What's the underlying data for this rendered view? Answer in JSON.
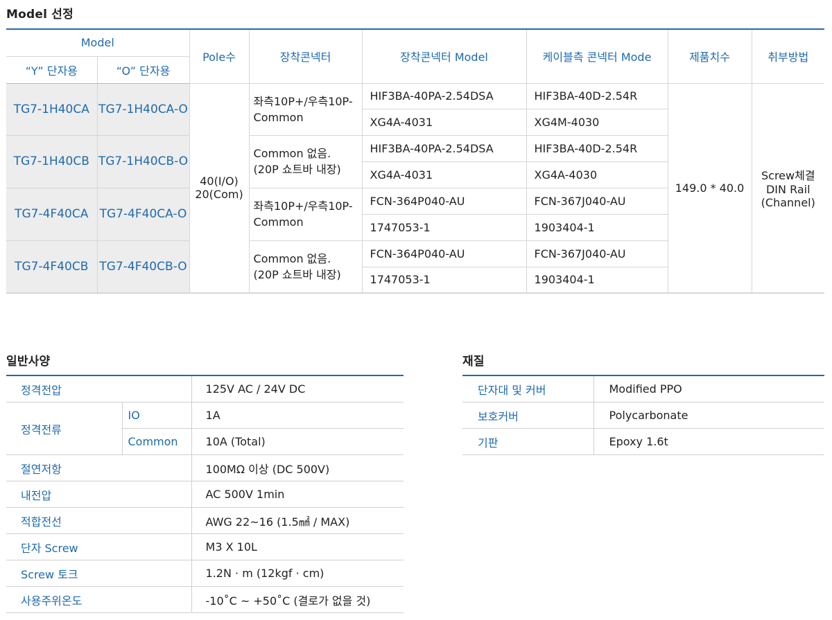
{
  "model_section": {
    "title": "Model 선정",
    "headers": {
      "model": "Model",
      "y_type": "“Y” 단자용",
      "o_type": "“O” 단자용",
      "pole": "Pole수",
      "connector": "장착콘넥터",
      "connector_model": "장착콘넥터 Model",
      "cable_connector": "케이블측 콘넥터 Mode",
      "dimensions": "제품치수",
      "mounting": "취부방법"
    },
    "rows": [
      {
        "y_model": "TG7-1H40CA",
        "o_model": "TG7-1H40CA-O",
        "connector_line1": "좌측10P+/우측10P-",
        "connector_line2": "Common",
        "connector_models": [
          "HIF3BA-40PA-2.54DSA",
          "XG4A-4031"
        ],
        "cable_models": [
          "HIF3BA-40D-2.54R",
          "XG4M-4030"
        ]
      },
      {
        "y_model": "TG7-1H40CB",
        "o_model": "TG7-1H40CB-O",
        "connector_line1": "Common 없음.",
        "connector_line2": "(20P 쇼트바 내장)",
        "connector_models": [
          "HIF3BA-40PA-2.54DSA",
          "XG4A-4031"
        ],
        "cable_models": [
          "HIF3BA-40D-2.54R",
          "XG4A-4030"
        ]
      },
      {
        "y_model": "TG7-4F40CA",
        "o_model": "TG7-4F40CA-O",
        "connector_line1": "좌측10P+/우측10P-",
        "connector_line2": "Common",
        "connector_models": [
          "FCN-364P040-AU",
          "1747053-1"
        ],
        "cable_models": [
          "FCN-367J040-AU",
          "1903404-1"
        ]
      },
      {
        "y_model": "TG7-4F40CB",
        "o_model": "TG7-4F40CB-O",
        "connector_line1": "Common 없음.",
        "connector_line2": "(20P 쇼트바 내장)",
        "connector_models": [
          "FCN-364P040-AU",
          "1747053-1"
        ],
        "cable_models": [
          "FCN-367J040-AU",
          "1903404-1"
        ]
      }
    ],
    "pole_line1": "40(I/O)",
    "pole_line2": "20(Com)",
    "dimensions": "149.0 * 40.0",
    "mounting_line1": "Screw체결",
    "mounting_line2": "DIN Rail",
    "mounting_line3": "(Channel)"
  },
  "general_section": {
    "title": "일반사양",
    "rated_voltage_label": "정격전압",
    "rated_voltage": "125V AC / 24V DC",
    "rated_current_label": "정격전류",
    "io_label": "IO",
    "io_value": "1A",
    "common_label": "Common",
    "common_value": "10A (Total)",
    "rows": [
      {
        "label": "절연저항",
        "value": "100MΩ 이상 (DC 500V)"
      },
      {
        "label": "내전압",
        "value": "AC 500V 1min"
      },
      {
        "label": "적합전선",
        "value": "AWG 22~16 (1.5㎟ / MAX)"
      },
      {
        "label": "단자 Screw",
        "value": "M3 X 10L"
      },
      {
        "label": "Screw 토크",
        "value": "1.2N · m (12kgf · cm)"
      },
      {
        "label": "사용주위온도",
        "value": "-10˚C ~ +50˚C (결로가 없을 것)"
      }
    ]
  },
  "material_section": {
    "title": "재질",
    "rows": [
      {
        "label": "단자대 및 커버",
        "value": "Modified PPO"
      },
      {
        "label": "보호커버",
        "value": "Polycarbonate"
      },
      {
        "label": "기판",
        "value": "Epoxy 1.6t"
      }
    ]
  },
  "colors": {
    "accent": "#1f6aad",
    "model_cell_bg": "#ededed",
    "border": "#d6d6d6"
  }
}
